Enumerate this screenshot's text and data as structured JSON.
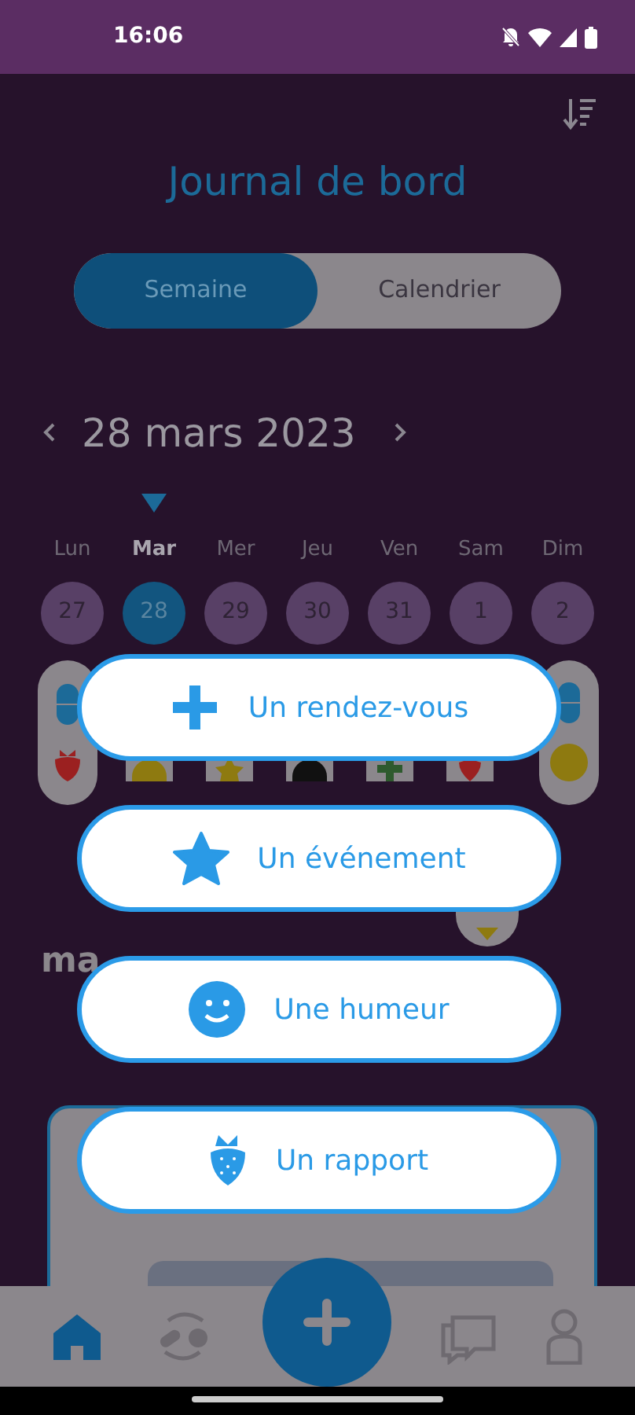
{
  "status_bar": {
    "time": "16:06"
  },
  "header": {
    "title": "Journal de bord"
  },
  "view_toggle": [
    {
      "label": "Semaine",
      "selected": true
    },
    {
      "label": "Calendrier",
      "selected": false
    }
  ],
  "date_nav": {
    "date": "28 mars 2023"
  },
  "week": [
    {
      "day": "Lun",
      "date": "27",
      "selected": false
    },
    {
      "day": "Mar",
      "date": "28",
      "selected": true
    },
    {
      "day": "Mer",
      "date": "29",
      "selected": false
    },
    {
      "day": "Jeu",
      "date": "30",
      "selected": false
    },
    {
      "day": "Ven",
      "date": "31",
      "selected": false
    },
    {
      "day": "Sam",
      "date": "1",
      "selected": false
    },
    {
      "day": "Dim",
      "date": "2",
      "selected": false
    }
  ],
  "section_heading": "ma",
  "add_menu": [
    {
      "label": "Un rendez-vous",
      "kind": "appointment"
    },
    {
      "label": "Un événement",
      "kind": "event"
    },
    {
      "label": "Une humeur",
      "kind": "mood"
    },
    {
      "label": "Un rapport",
      "kind": "report"
    }
  ],
  "bottom_nav": [
    {
      "kind": "home",
      "selected": true
    },
    {
      "kind": "treatment",
      "selected": false
    },
    {
      "kind": "add",
      "selected": false
    },
    {
      "kind": "messages",
      "selected": false
    },
    {
      "kind": "profile",
      "selected": false
    }
  ]
}
